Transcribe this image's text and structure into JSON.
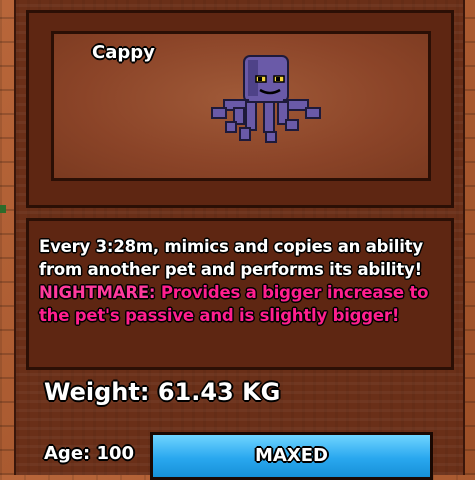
{
  "pet": {
    "name": "Cappy",
    "figure_icon": "purple-octopus-pet",
    "figure_color": "#6a5aa8"
  },
  "description": {
    "line1": "Every 3:28m, mimics and copies an ability",
    "line2": "from another pet and performs its ability!",
    "nightmare_label": "NIGHTMARE:",
    "nightmare_line1_rest": " Provides a bigger increase to",
    "nightmare_line2": "the pet's passive and is slightly bigger!"
  },
  "stats": {
    "weight": "Weight: 61.43 KG",
    "age": "Age: 100",
    "age_status": "MAXED",
    "age_progress": 1.0
  },
  "colors": {
    "nightmare": "#ff1f8e",
    "age_bar": "#2aa8ef"
  }
}
